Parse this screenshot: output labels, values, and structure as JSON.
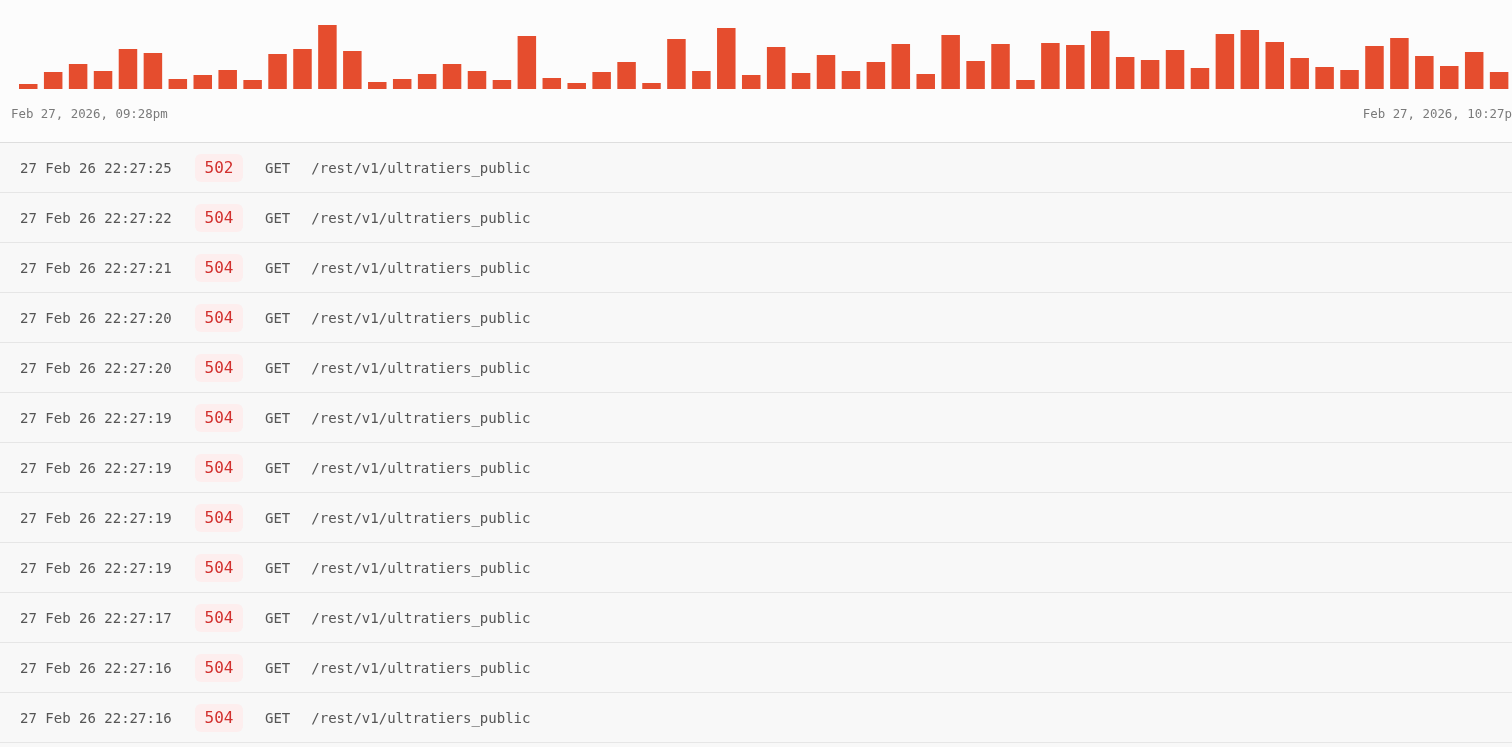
{
  "chart": {
    "start_label": "Feb 27, 2026, 09:28pm",
    "end_label": "Feb 27, 2026, 10:27p"
  },
  "log_rows": [
    {
      "time": "27 Feb 26 22:27:25",
      "status": "502",
      "method": "GET",
      "path": "/rest/v1/ultratiers_public"
    },
    {
      "time": "27 Feb 26 22:27:22",
      "status": "504",
      "method": "GET",
      "path": "/rest/v1/ultratiers_public"
    },
    {
      "time": "27 Feb 26 22:27:21",
      "status": "504",
      "method": "GET",
      "path": "/rest/v1/ultratiers_public"
    },
    {
      "time": "27 Feb 26 22:27:20",
      "status": "504",
      "method": "GET",
      "path": "/rest/v1/ultratiers_public"
    },
    {
      "time": "27 Feb 26 22:27:20",
      "status": "504",
      "method": "GET",
      "path": "/rest/v1/ultratiers_public"
    },
    {
      "time": "27 Feb 26 22:27:19",
      "status": "504",
      "method": "GET",
      "path": "/rest/v1/ultratiers_public"
    },
    {
      "time": "27 Feb 26 22:27:19",
      "status": "504",
      "method": "GET",
      "path": "/rest/v1/ultratiers_public"
    },
    {
      "time": "27 Feb 26 22:27:19",
      "status": "504",
      "method": "GET",
      "path": "/rest/v1/ultratiers_public"
    },
    {
      "time": "27 Feb 26 22:27:19",
      "status": "504",
      "method": "GET",
      "path": "/rest/v1/ultratiers_public"
    },
    {
      "time": "27 Feb 26 22:27:17",
      "status": "504",
      "method": "GET",
      "path": "/rest/v1/ultratiers_public"
    },
    {
      "time": "27 Feb 26 22:27:16",
      "status": "504",
      "method": "GET",
      "path": "/rest/v1/ultratiers_public"
    },
    {
      "time": "27 Feb 26 22:27:16",
      "status": "504",
      "method": "GET",
      "path": "/rest/v1/ultratiers_public"
    }
  ]
}
